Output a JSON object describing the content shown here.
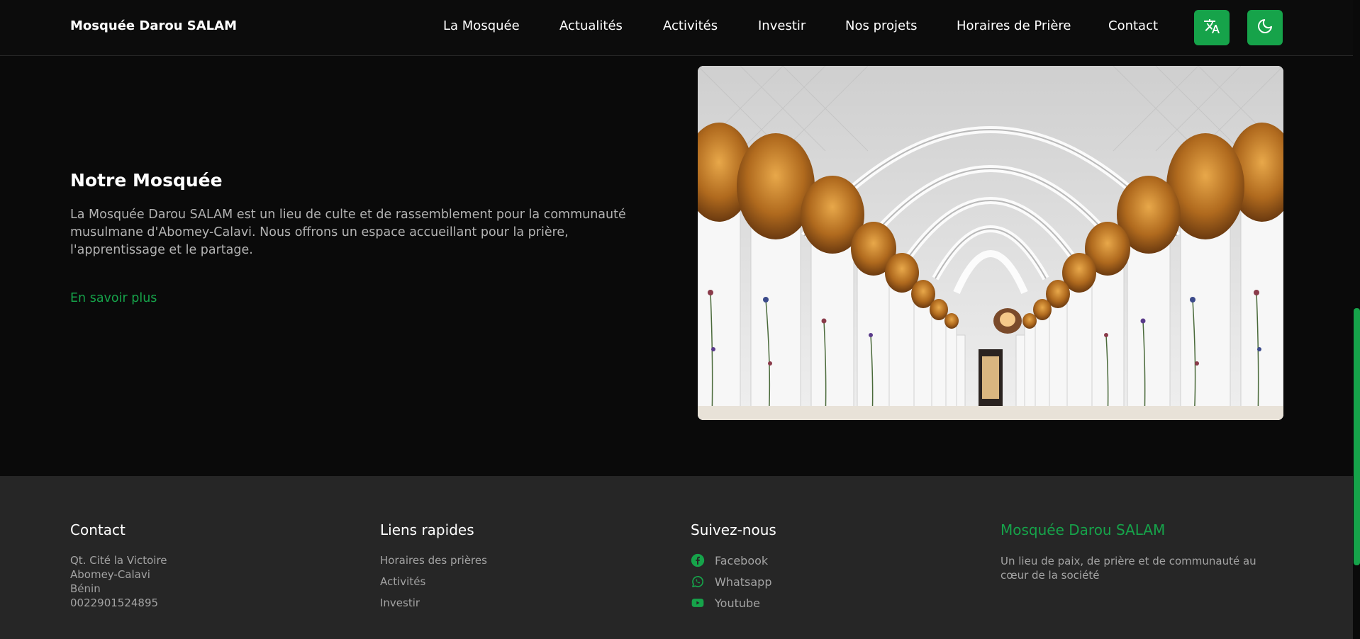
{
  "header": {
    "brand": "Mosquée Darou SALAM",
    "nav": [
      {
        "label": "La Mosquée"
      },
      {
        "label": "Actualités"
      },
      {
        "label": "Activités"
      },
      {
        "label": "Investir"
      },
      {
        "label": "Nos projets"
      },
      {
        "label": "Horaires de Prière"
      },
      {
        "label": "Contact"
      }
    ],
    "translate_icon": "translate-icon",
    "theme_icon": "moon-icon"
  },
  "about": {
    "title": "Notre Mosquée",
    "text": "La Mosquée Darou SALAM est un lieu de culte et de rassemblement pour la communauté musulmane d'Abomey-Calavi. Nous offrons un espace accueillant pour la prière, l'apprentissage et le partage.",
    "link": "En savoir plus"
  },
  "footer": {
    "contact": {
      "title": "Contact",
      "lines": [
        "Qt. Cité la Victoire",
        "Abomey-Calavi",
        "Bénin",
        "0022901524895"
      ]
    },
    "quick_links": {
      "title": "Liens rapides",
      "items": [
        "Horaires des prières",
        "Activités",
        "Investir"
      ]
    },
    "follow": {
      "title": "Suivez-nous",
      "items": [
        {
          "label": "Facebook",
          "icon": "facebook-icon"
        },
        {
          "label": "Whatsapp",
          "icon": "whatsapp-icon"
        },
        {
          "label": "Youtube",
          "icon": "youtube-icon"
        }
      ]
    },
    "about": {
      "title": "Mosquée Darou SALAM",
      "tagline": "Un lieu de paix, de prière et de communauté au cœur de la société"
    }
  },
  "colors": {
    "accent": "#16a34a",
    "background": "#0a0a0a",
    "footer_background": "#262626"
  }
}
